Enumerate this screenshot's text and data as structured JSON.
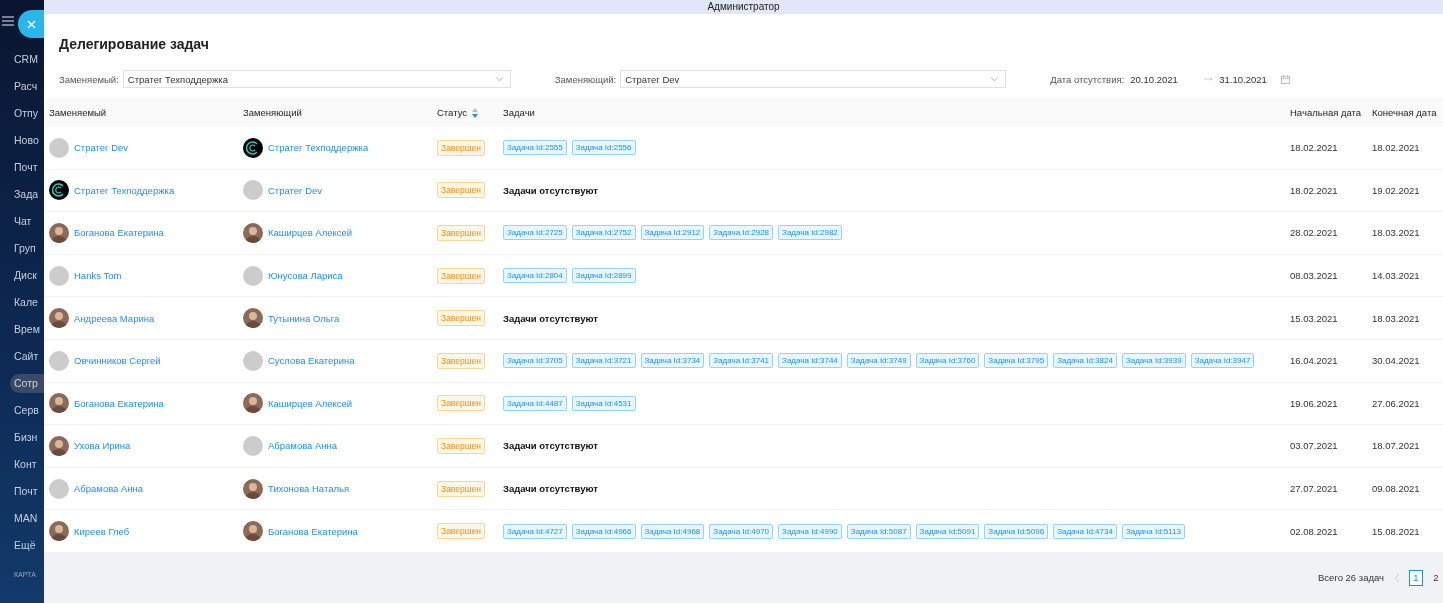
{
  "topbar": {
    "user": "Администратор"
  },
  "sidebar": {
    "items": [
      {
        "label": "CRM",
        "selected": false
      },
      {
        "label": "Расч",
        "selected": false
      },
      {
        "label": "Отпу",
        "selected": false
      },
      {
        "label": "Ново",
        "selected": false
      },
      {
        "label": "Почт",
        "selected": false
      },
      {
        "label": "Зада",
        "selected": false
      },
      {
        "label": "Чат",
        "selected": false
      },
      {
        "label": "Груп",
        "selected": false
      },
      {
        "label": "Диск",
        "selected": false
      },
      {
        "label": "Кале",
        "selected": false
      },
      {
        "label": "Врем",
        "selected": false
      },
      {
        "label": "Сайт",
        "selected": false
      },
      {
        "label": "Сотр",
        "selected": true
      },
      {
        "label": "Серв",
        "selected": false
      },
      {
        "label": "Бизн",
        "selected": false
      },
      {
        "label": "Конт",
        "selected": false
      },
      {
        "label": "Почт",
        "selected": false
      },
      {
        "label": "MAN",
        "selected": false
      },
      {
        "label": "Ещё",
        "selected": false
      }
    ],
    "footer": "КАРТА"
  },
  "page": {
    "title": "Делегирование задач"
  },
  "filters": {
    "replaced": {
      "label": "Заменяемый:",
      "value": "Стратег Техподдержка"
    },
    "replacing": {
      "label": "Заменяющий:",
      "value": "Стратег Dev"
    },
    "absence": {
      "label": "Дата отсутствия:",
      "start": "20.10.2021",
      "end": "31.10.2021"
    }
  },
  "table": {
    "columns": [
      {
        "label": "Заменяемый",
        "sortable": false
      },
      {
        "label": "Заменяющий",
        "sortable": false
      },
      {
        "label": "Статус",
        "sortable": true
      },
      {
        "label": "Задачи",
        "sortable": false
      },
      {
        "label": "Начальная дата",
        "sortable": false
      },
      {
        "label": "Конечная дата",
        "sortable": false
      }
    ],
    "rows": [
      {
        "replaced": {
          "name": "Стратег Dev",
          "kind": "blank"
        },
        "replacing": {
          "name": "Стратег Техподдержка",
          "kind": "logo"
        },
        "status": "Завершен",
        "tasks": [
          "Задача Id:2555",
          "Задача Id:2556"
        ],
        "start": "18.02.2021",
        "end": "18.02.2021"
      },
      {
        "replaced": {
          "name": "Стратег Техподдержка",
          "kind": "logo"
        },
        "replacing": {
          "name": "Стратег Dev",
          "kind": "blank"
        },
        "status": "Завершен",
        "tasks_note": "Задачи отсутствуют",
        "start": "18.02.2021",
        "end": "19.02.2021"
      },
      {
        "replaced": {
          "name": "Боганова Екатерина",
          "kind": "photo"
        },
        "replacing": {
          "name": "Каширцев Алексей",
          "kind": "photo"
        },
        "status": "Завершен",
        "tasks": [
          "Задача Id:2725",
          "Задача Id:2752",
          "Задача Id:2912",
          "Задача Id:2928",
          "Задача Id:2982"
        ],
        "start": "28.02.2021",
        "end": "18.03.2021"
      },
      {
        "replaced": {
          "name": "Hanks Tom",
          "kind": "blank"
        },
        "replacing": {
          "name": "Юнусова Лариса",
          "kind": "blank"
        },
        "status": "Завершен",
        "tasks": [
          "Задача Id:2804",
          "Задача Id:2899"
        ],
        "start": "08.03.2021",
        "end": "14.03.2021"
      },
      {
        "replaced": {
          "name": "Андреева Марина",
          "kind": "photo"
        },
        "replacing": {
          "name": "Тутынина Ольга",
          "kind": "photo"
        },
        "status": "Завершен",
        "tasks_note": "Задачи отсутствуют",
        "start": "15.03.2021",
        "end": "18.03.2021"
      },
      {
        "replaced": {
          "name": "Овчинников Сергей",
          "kind": "blank"
        },
        "replacing": {
          "name": "Суслова Екатерина",
          "kind": "blank"
        },
        "status": "Завершен",
        "tasks": [
          "Задача Id:3705",
          "Задача Id:3721",
          "Задача Id:3734",
          "Задача Id:3741",
          "Задача Id:3744",
          "Задача Id:3749",
          "Задача Id:3760",
          "Задача Id:3795",
          "Задача Id:3824",
          "Задача Id:3939",
          "Задача Id:3947"
        ],
        "start": "16.04.2021",
        "end": "30.04.2021"
      },
      {
        "replaced": {
          "name": "Боганова Екатерина",
          "kind": "photo"
        },
        "replacing": {
          "name": "Каширцев Алексей",
          "kind": "photo"
        },
        "status": "Завершен",
        "tasks": [
          "Задача Id:4487",
          "Задача Id:4531"
        ],
        "start": "19.06.2021",
        "end": "27.06.2021"
      },
      {
        "replaced": {
          "name": "Ухова Ирина",
          "kind": "photo"
        },
        "replacing": {
          "name": "Абрамова Анна",
          "kind": "blank"
        },
        "status": "Завершен",
        "tasks_note": "Задачи отсутствуют",
        "start": "03.07.2021",
        "end": "18.07.2021"
      },
      {
        "replaced": {
          "name": "Абрамова Анна",
          "kind": "blank"
        },
        "replacing": {
          "name": "Тихонова Наталья",
          "kind": "photo"
        },
        "status": "Завершен",
        "tasks_note": "Задачи отсутствуют",
        "start": "27.07.2021",
        "end": "09.08.2021"
      },
      {
        "replaced": {
          "name": "Киреев Глеб",
          "kind": "photo"
        },
        "replacing": {
          "name": "Боганова Екатерина",
          "kind": "photo"
        },
        "status": "Завершен",
        "tasks": [
          "Задача Id:4727",
          "Задача Id:4966",
          "Задача Id:4968",
          "Задача Id:4970",
          "Задача Id:4990",
          "Задача Id:5087",
          "Задача Id:5091",
          "Задача Id:5096",
          "Задача Id:4734",
          "Задача Id:5113"
        ],
        "start": "02.08.2021",
        "end": "15.08.2021"
      }
    ]
  },
  "pagination": {
    "total": "Всего 26 задач",
    "pages": [
      {
        "label": "1",
        "selected": true
      },
      {
        "label": "2",
        "selected": false
      }
    ]
  }
}
